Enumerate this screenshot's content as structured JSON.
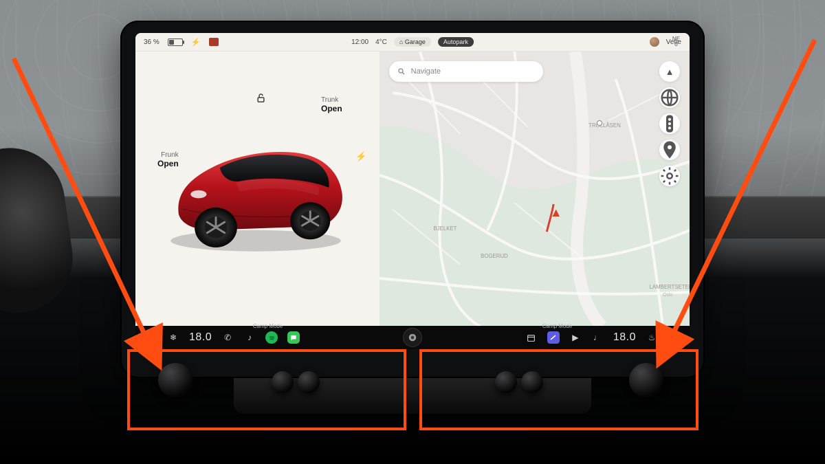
{
  "status": {
    "battery_percent": "36 %",
    "time": "12:00",
    "outside_temp": "4°C",
    "garage_label": "Garage",
    "autopark_label": "Autopark",
    "profile_name": "Vetle",
    "compass_heading": "NE",
    "compass_bearing": "0"
  },
  "car_pane": {
    "frunk_label": "Frunk",
    "frunk_action": "Open",
    "trunk_label": "Trunk",
    "trunk_action": "Open"
  },
  "map": {
    "search_placeholder": "Navigate",
    "locality_1": "TROLLÅSEN",
    "locality_2": "BJELKET",
    "locality_3": "BOGERUD",
    "locality_4": "LAMBERTSETER",
    "locality_5": "Oslo"
  },
  "dock": {
    "mode_label": "Camp Mode",
    "temp_left": "18.0",
    "temp_right": "18.0"
  },
  "colors": {
    "accent": "#ff4d12",
    "car_body": "#b5121b"
  }
}
